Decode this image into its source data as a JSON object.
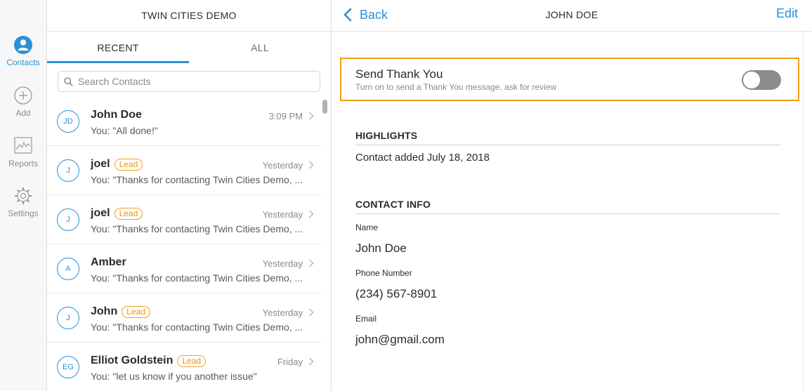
{
  "nav": {
    "items": [
      {
        "label": "Contacts",
        "icon": "contacts-icon",
        "active": true
      },
      {
        "label": "Add",
        "icon": "add-icon",
        "active": false
      },
      {
        "label": "Reports",
        "icon": "reports-icon",
        "active": false
      },
      {
        "label": "Settings",
        "icon": "settings-icon",
        "active": false
      }
    ]
  },
  "list": {
    "header_title": "TWIN CITIES DEMO",
    "tabs": [
      {
        "label": "RECENT",
        "active": true
      },
      {
        "label": "ALL",
        "active": false
      }
    ],
    "search": {
      "placeholder": "Search Contacts",
      "value": ""
    },
    "contacts": [
      {
        "initials": "JD",
        "name": "John Doe",
        "badge": "",
        "time": "3:09 PM",
        "message": "You: \"All done!\""
      },
      {
        "initials": "J",
        "name": "joel",
        "badge": "Lead",
        "time": "Yesterday",
        "message": "You: \"Thanks for contacting Twin Cities Demo, ..."
      },
      {
        "initials": "J",
        "name": "joel",
        "badge": "Lead",
        "time": "Yesterday",
        "message": "You: \"Thanks for contacting Twin Cities Demo, ..."
      },
      {
        "initials": "A",
        "name": "Amber",
        "badge": "",
        "time": "Yesterday",
        "message": "You: \"Thanks for contacting Twin Cities Demo, ..."
      },
      {
        "initials": "J",
        "name": "John",
        "badge": "Lead",
        "time": "Yesterday",
        "message": "You: \"Thanks for contacting Twin Cities Demo, ..."
      },
      {
        "initials": "EG",
        "name": "Elliot Goldstein",
        "badge": "Lead",
        "time": "Friday",
        "message": "You: \"let us know if you another issue\""
      }
    ]
  },
  "detail": {
    "back_label": "Back",
    "title": "JOHN DOE",
    "edit_label": "Edit",
    "thank_you": {
      "title": "Send Thank You",
      "subtitle": "Turn on to send a Thank You message, ask for review",
      "enabled": false
    },
    "highlights": {
      "heading": "HIGHLIGHTS",
      "text": "Contact added July 18, 2018"
    },
    "contact_info": {
      "heading": "CONTACT INFO",
      "name_label": "Name",
      "name_value": "John Doe",
      "phone_label": "Phone Number",
      "phone_value": "(234) 567-8901",
      "email_label": "Email",
      "email_value": "john@gmail.com"
    }
  },
  "colors": {
    "accent": "#2a91d6",
    "lead_badge": "#f0a020",
    "highlight_border": "#f39c12",
    "toggle_off": "#8c8c8c"
  }
}
